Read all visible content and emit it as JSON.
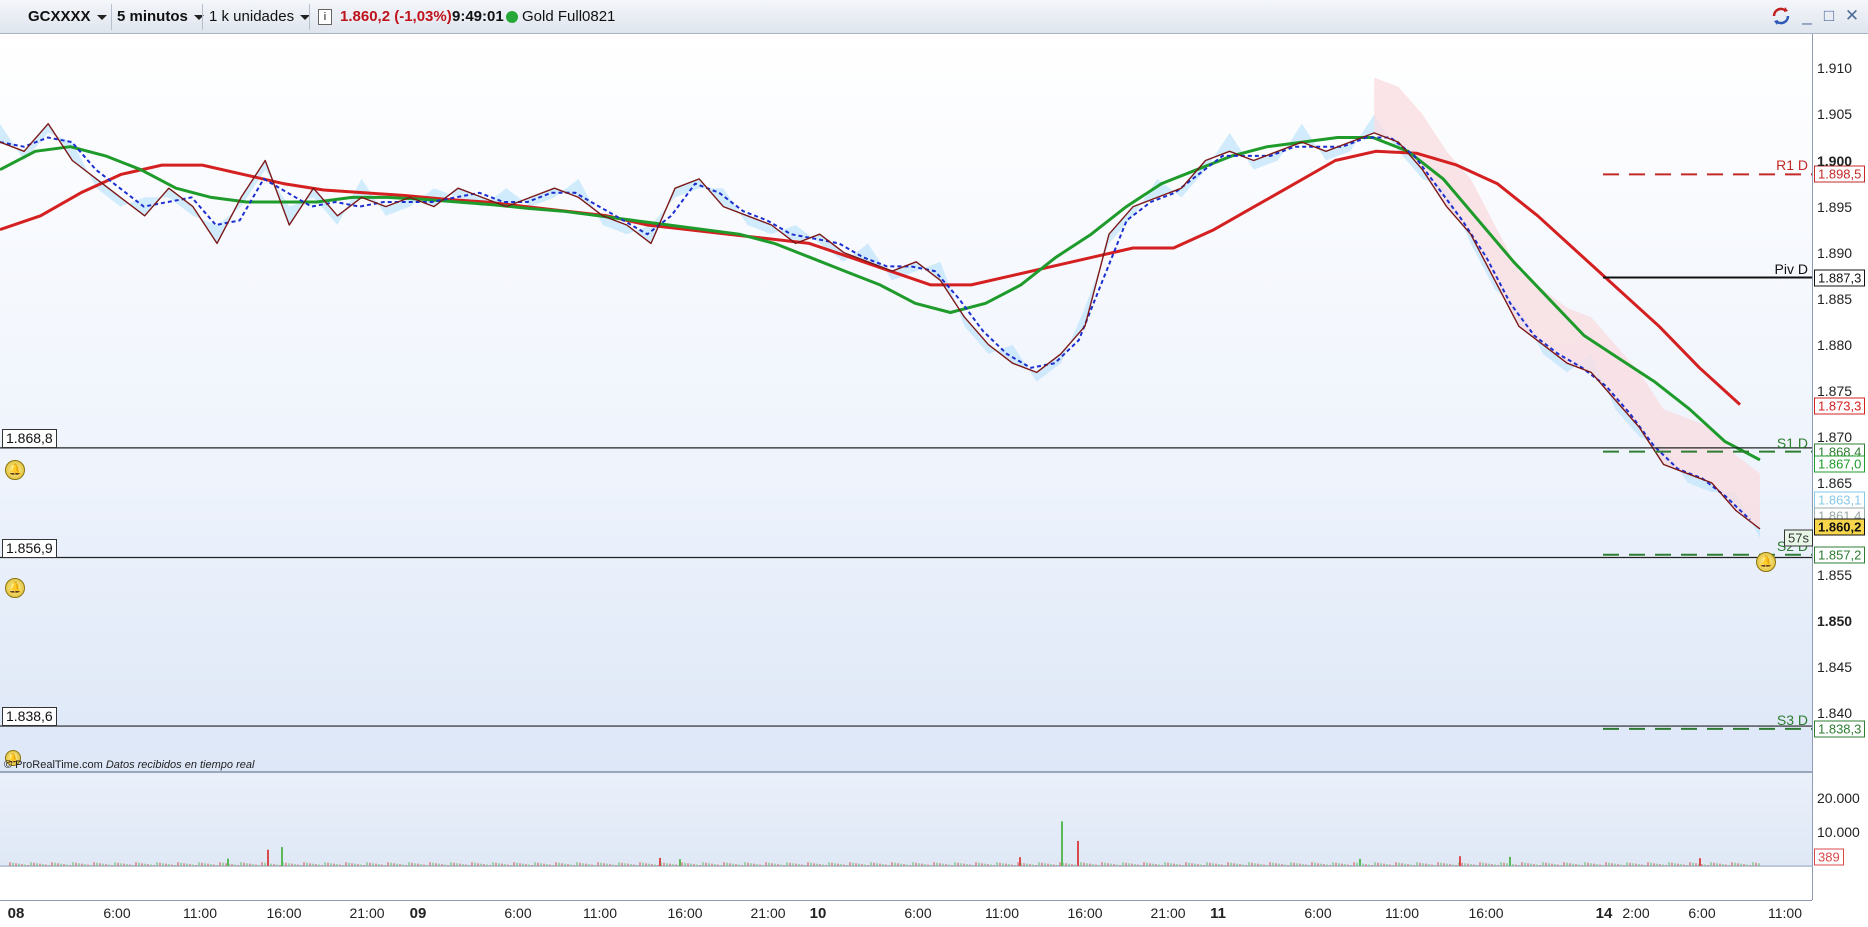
{
  "toolbar": {
    "symbol": "GCXXXX",
    "timeframe": "5 minutos",
    "units": "1 k unidades",
    "price_change": "1.860,2 (-1,03%)",
    "time": "9:49:01",
    "instrument": "Gold Full0821",
    "window_buttons": [
      "_",
      "□",
      "✕"
    ]
  },
  "colors": {
    "ema_red": "#d42020",
    "ema_green": "#1e9b2a",
    "dash_blue": "#1c2fd0",
    "price_line": "#7b1818",
    "cloud_blue": "#bfe4fb",
    "cloud_pink": "#f9dde1",
    "vol_green": "#5aba5a",
    "vol_red": "#d94a4a"
  },
  "price_axis": {
    "ticks": [
      "1.910",
      "1.905",
      "1.900",
      "1.895",
      "1.890",
      "1.885",
      "1.880",
      "1.875",
      "1.870",
      "1.865",
      "1.855",
      "1.850",
      "1.845",
      "1.840"
    ],
    "major": [
      "1.900",
      "1.850"
    ]
  },
  "volume_axis": {
    "ticks": [
      "20.000",
      "10.000"
    ],
    "badge": "389"
  },
  "levels": [
    {
      "name": "R1 D",
      "price": "1.898,5",
      "color": "#c62828",
      "style": "dashed"
    },
    {
      "name": "Piv D",
      "price": "1.887,3",
      "color": "#111111",
      "style": "solid"
    },
    {
      "name": "S1 D",
      "price": "1.868,4",
      "color": "#2e7d32",
      "style": "dashed"
    },
    {
      "name": "S2 D",
      "price": "1.857,2",
      "color": "#2e7d32",
      "style": "dashed"
    },
    {
      "name": "S3 D",
      "price": "1.838,3",
      "color": "#2e7d32",
      "style": "dashed"
    }
  ],
  "price_boxes": [
    {
      "text": "1.873,3",
      "color": "#d42020"
    },
    {
      "text": "1.867,0",
      "color": "#1e9b2a"
    },
    {
      "text": "1.863,1",
      "color": "#86c8e6"
    },
    {
      "text": "1.861,4",
      "color": "#9aa"
    },
    {
      "text": "1.860,2",
      "color": "#111"
    },
    {
      "text": "57s",
      "color": "#333"
    }
  ],
  "hlines": [
    {
      "text": "1.868,8"
    },
    {
      "text": "1.856,9"
    },
    {
      "text": "1.838,6"
    }
  ],
  "footer": {
    "brand": "© ProRealTime.com",
    "status": "Datos recibidos en tiempo real"
  },
  "x_axis": {
    "labels": [
      {
        "text": "08",
        "day": true
      },
      {
        "text": "6:00"
      },
      {
        "text": "11:00"
      },
      {
        "text": "16:00"
      },
      {
        "text": "21:00"
      },
      {
        "text": "09",
        "day": true
      },
      {
        "text": "6:00"
      },
      {
        "text": "11:00"
      },
      {
        "text": "16:00"
      },
      {
        "text": "21:00"
      },
      {
        "text": "10",
        "day": true
      },
      {
        "text": "6:00"
      },
      {
        "text": "11:00"
      },
      {
        "text": "16:00"
      },
      {
        "text": "21:00"
      },
      {
        "text": "11",
        "day": true
      },
      {
        "text": "6:00"
      },
      {
        "text": "11:00"
      },
      {
        "text": "16:00"
      },
      {
        "text": "14",
        "day": true
      },
      {
        "text": "2:00"
      },
      {
        "text": "6:00"
      },
      {
        "text": "11:00"
      }
    ]
  },
  "chart_data": {
    "type": "line",
    "title": "",
    "ylim": [
      1.836,
      1.912
    ],
    "price": [
      1.902,
      1.901,
      1.904,
      1.9,
      1.898,
      1.896,
      1.894,
      1.897,
      1.895,
      1.891,
      1.896,
      1.9,
      1.893,
      1.897,
      1.894,
      1.896,
      1.895,
      1.896,
      1.895,
      1.897,
      1.896,
      1.895,
      1.896,
      1.897,
      1.896,
      1.894,
      1.893,
      1.891,
      1.897,
      1.898,
      1.895,
      1.894,
      1.893,
      1.891,
      1.892,
      1.89,
      1.889,
      1.888,
      1.889,
      1.887,
      1.883,
      1.88,
      1.878,
      1.877,
      1.879,
      1.882,
      1.892,
      1.895,
      1.896,
      1.897,
      1.9,
      1.901,
      1.9,
      1.901,
      1.902,
      1.901,
      1.902,
      1.903,
      1.902,
      1.899,
      1.895,
      1.892,
      1.887,
      1.882,
      1.88,
      1.878,
      1.877,
      1.874,
      1.871,
      1.867,
      1.866,
      1.865,
      1.862,
      1.86
    ],
    "ema_green": [
      1.899,
      1.901,
      1.9015,
      1.9005,
      1.899,
      1.897,
      1.896,
      1.8955,
      1.8955,
      1.8955,
      1.896,
      1.896,
      1.8958,
      1.8955,
      1.8952,
      1.8948,
      1.8945,
      1.894,
      1.8935,
      1.893,
      1.8925,
      1.892,
      1.891,
      1.8895,
      1.888,
      1.8865,
      1.8845,
      1.8835,
      1.8845,
      1.8865,
      1.8895,
      1.892,
      1.895,
      1.8975,
      1.899,
      1.9005,
      1.9015,
      1.902,
      1.9025,
      1.9025,
      1.901,
      1.898,
      1.8935,
      1.889,
      1.885,
      1.881,
      1.8785,
      1.876,
      1.873,
      1.8695,
      1.8675
    ],
    "ema_red": [
      1.8925,
      1.894,
      1.8965,
      1.8985,
      1.8995,
      1.8995,
      1.8985,
      1.8975,
      1.8968,
      1.8965,
      1.8962,
      1.8958,
      1.8955,
      1.895,
      1.8945,
      1.894,
      1.893,
      1.8925,
      1.892,
      1.8915,
      1.891,
      1.8895,
      1.888,
      1.8865,
      1.8865,
      1.8875,
      1.8885,
      1.8895,
      1.8905,
      1.8905,
      1.8925,
      1.895,
      1.8975,
      1.9,
      1.901,
      1.9008,
      1.8995,
      1.8975,
      1.894,
      1.89,
      1.886,
      1.882,
      1.8775,
      1.8735
    ]
  },
  "volume_data": {
    "spikes": [
      {
        "value": 2200
      },
      {
        "value": 4800
      },
      {
        "value": 5600
      },
      {
        "value": 2400
      },
      {
        "value": 2000
      },
      {
        "value": 2600
      },
      {
        "value": 13200
      },
      {
        "value": 7400
      },
      {
        "value": 2100
      },
      {
        "value": 2900
      },
      {
        "value": 2700
      },
      {
        "value": 2300
      }
    ],
    "max": 26000
  }
}
